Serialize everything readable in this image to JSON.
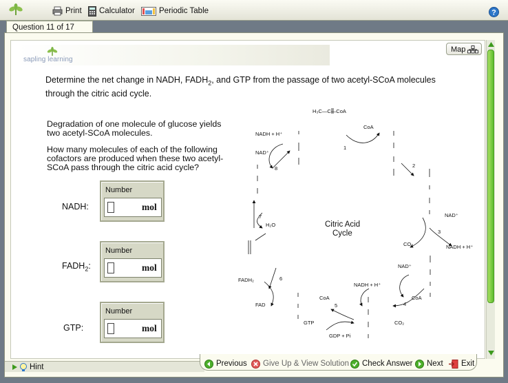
{
  "toolbar": {
    "print": "Print",
    "calculator": "Calculator",
    "periodic_table": "Periodic Table"
  },
  "tab": {
    "label": "Question 11 of 17"
  },
  "logo": {
    "text": "sapling learning"
  },
  "map_button": {
    "label": "Map"
  },
  "question": {
    "prompt_a": "Determine the net change in NADH, FADH",
    "prompt_sub": "2",
    "prompt_b": ", and GTP from the passage of two acetyl-SCoA molecules through the citric acid cycle.",
    "statement": "Degradation of one molecule of glucose yields two acetyl-SCoA molecules.",
    "ask": "How many molecules of each of the following cofactors are produced when these two acetyl-SCoA pass through the citric acid cycle?"
  },
  "answers": [
    {
      "label": "NADH:",
      "box_label": "Number",
      "unit": "mol",
      "value": ""
    },
    {
      "label_a": "FADH",
      "label_sub": "2",
      "label_b": ":",
      "box_label": "Number",
      "unit": "mol",
      "value": ""
    },
    {
      "label": "GTP:",
      "box_label": "Number",
      "unit": "mol",
      "value": ""
    }
  ],
  "diagram": {
    "title_line1": "Citric Acid",
    "title_line2": "Cycle",
    "labels": {
      "acetyl": "H₃C—C—CoA",
      "coa": "CoA",
      "nadh1": "NADH + H⁺",
      "nad1": "NAD⁺",
      "h2o": "H₂O",
      "fadh2": "FADH₂",
      "fad": "FAD",
      "coa2": "CoA",
      "gtp": "GTP",
      "gdp": "GDP + Pi",
      "nad2": "NAD⁺",
      "nadh2": "NADH + H⁺",
      "coa3": "CoA",
      "co2a": "CO₂",
      "co2b": "CO₂",
      "nad3": "NAD⁺",
      "nadh3": "NADH + H⁺"
    },
    "steps": [
      "1",
      "2",
      "3",
      "4",
      "5",
      "6",
      "7",
      "8"
    ]
  },
  "nav": {
    "hint": "Hint",
    "previous": "Previous",
    "give_up": "Give Up & View Solution",
    "check": "Check Answer",
    "next": "Next",
    "exit": "Exit"
  }
}
